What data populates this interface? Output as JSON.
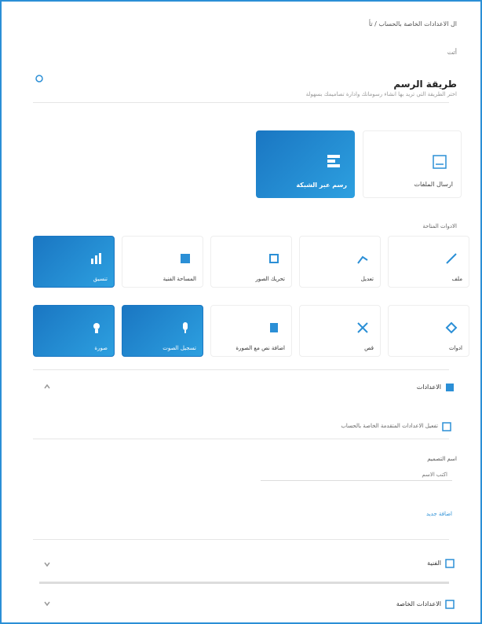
{
  "header": {
    "breadcrumb": "ال الاعدادات الخاصة بالحساب / تأ",
    "subtitle": "أتت",
    "title": "طريقة الرسم",
    "description": "اختر الطريقة التي تريد بها انشاء رسوماتك وادارة تصاميمك بسهولة"
  },
  "big_cards": [
    {
      "label": "رسم عبر الشبكة",
      "state": "active",
      "icon": "grid-icon"
    },
    {
      "label": "ارسال الملفات",
      "state": "inactive",
      "icon": "upload-icon"
    }
  ],
  "section_label": "الادوات المتاحة",
  "tiles": [
    {
      "label": "ملف",
      "num": "",
      "active": false,
      "icon": "pencil-icon"
    },
    {
      "label": "تعديل",
      "num": "",
      "active": false,
      "icon": "brush-icon"
    },
    {
      "label": "تحريك الصور",
      "num": "",
      "active": false,
      "icon": "layers-icon"
    },
    {
      "label": "المساحة الفنية",
      "num": "",
      "active": false,
      "icon": "edit-icon"
    },
    {
      "label": "تنسيق",
      "num": "",
      "active": true,
      "icon": "chart-icon"
    },
    {
      "label": "ادوات",
      "num": "",
      "active": false,
      "icon": "tool-icon"
    },
    {
      "label": "قص",
      "num": "",
      "active": false,
      "icon": "scissors-icon"
    },
    {
      "label": "اضافة نص مع الصورة",
      "num": "",
      "active": false,
      "icon": "text-icon"
    },
    {
      "label": "تسجيل الصوت",
      "num": "",
      "active": true,
      "icon": "mic-icon"
    },
    {
      "label": "صورة",
      "num": "",
      "active": true,
      "icon": "image-icon"
    }
  ],
  "panel": {
    "title": "الاعدادات",
    "option_text": "تفعيل الاعدادات المتقدمة الخاصة بالحساب",
    "field_label": "اسم التصميم",
    "field_placeholder": "اكتب الاسم",
    "link": "اضافة جديد",
    "row2_title": "الفنية",
    "row3_title": "الاعدادات الخاصة"
  },
  "colors": {
    "accent": "#1a76c2",
    "frame": "#2b8fd6"
  }
}
